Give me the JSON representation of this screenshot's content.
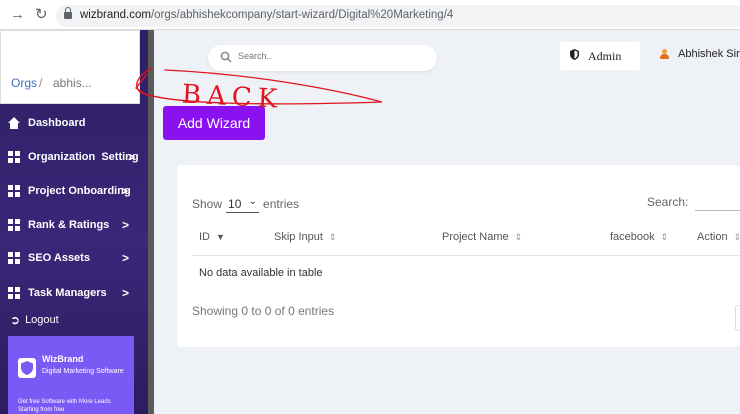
{
  "browser": {
    "url_host": "wizbrand.com",
    "url_path": "/orgs/abhishekcompany/start-wizard/Digital%20Marketing/4",
    "back_icon": "arrow-right-icon",
    "reload_icon": "reload-icon"
  },
  "breadcrumb": {
    "root": "Orgs",
    "separator": "/",
    "current": "abhis..."
  },
  "sidebar": {
    "items": [
      {
        "label": "Dashboard",
        "icon": "home-icon",
        "has_chevron": false
      },
      {
        "label": "Organization  Setting",
        "icon": "grid-icon",
        "has_chevron": true
      },
      {
        "label": "Project Onboarding",
        "icon": "grid-icon",
        "has_chevron": true
      },
      {
        "label": "Rank & Ratings",
        "icon": "grid-icon",
        "has_chevron": true
      },
      {
        "label": "SEO Assets",
        "icon": "grid-icon",
        "has_chevron": true
      },
      {
        "label": "Task Managers",
        "icon": "grid-icon",
        "has_chevron": true
      }
    ],
    "chevron": ">",
    "logout_label": "Logout"
  },
  "promo": {
    "brand": "WizBrand",
    "tagline": "Digital Marketing Software",
    "note": "Get free Software with More Leads Starting from free"
  },
  "header": {
    "search_placeholder": "Search..",
    "admin_label": "Admin",
    "user_name": "Abhishek Singh"
  },
  "main": {
    "add_wizard_label": "Add Wizard"
  },
  "table": {
    "show_label": "Show",
    "entries_value": "10",
    "entries_label": "entries",
    "search_label": "Search:",
    "columns": [
      "ID",
      "Skip Input",
      "Project Name",
      "facebook",
      "Action"
    ],
    "empty_message": "No data available in table",
    "info": "Showing 0 to 0 of 0 entries"
  },
  "annotation": {
    "text": "BACK",
    "color": "#e0141e"
  },
  "colors": {
    "accent": "#8a12f0",
    "sidebar": "#2d1f63",
    "promo": "#7a5af5"
  }
}
